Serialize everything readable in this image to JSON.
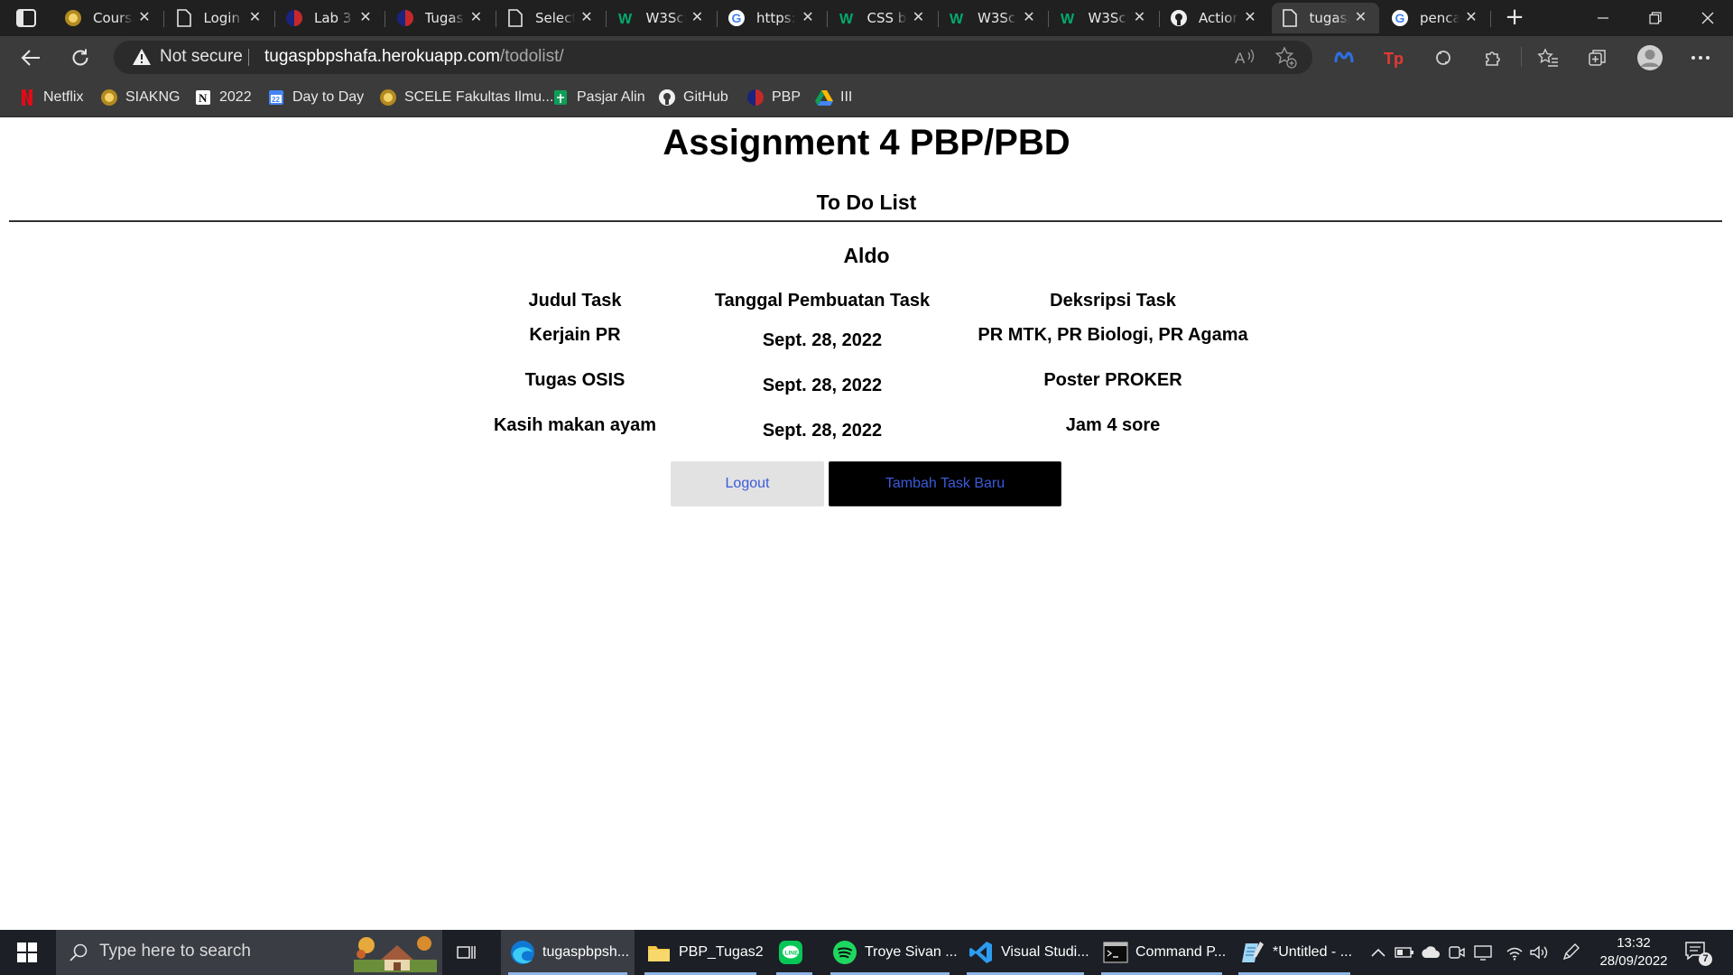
{
  "browser": {
    "tabs": [
      {
        "title": "Course",
        "icon": "university-crest-icon"
      },
      {
        "title": "Login",
        "icon": "page-icon"
      },
      {
        "title": "Lab 3:",
        "icon": "pbp-logo-icon"
      },
      {
        "title": "Tugas",
        "icon": "pbp-logo-icon"
      },
      {
        "title": "Select",
        "icon": "page-icon"
      },
      {
        "title": "W3Sch",
        "icon": "w3schools-icon"
      },
      {
        "title": "https:/",
        "icon": "google-icon"
      },
      {
        "title": "CSS b",
        "icon": "w3schools-icon"
      },
      {
        "title": "W3Sch",
        "icon": "w3schools-icon"
      },
      {
        "title": "W3Sch",
        "icon": "w3schools-icon"
      },
      {
        "title": "Action",
        "icon": "github-icon"
      },
      {
        "title": "tugasp",
        "icon": "page-icon",
        "active": true
      },
      {
        "title": "penca",
        "icon": "google-icon"
      }
    ],
    "security_label": "Not secure",
    "url_host": "tugaspbpshafa.herokuapp.com",
    "url_path": "/todolist/",
    "bookmarks": [
      {
        "label": "Netflix",
        "icon": "netflix-icon"
      },
      {
        "label": "SIAKNG",
        "icon": "university-crest-icon"
      },
      {
        "label": "2022",
        "icon": "notion-icon"
      },
      {
        "label": "Day to Day",
        "icon": "calendar-icon"
      },
      {
        "label": "SCELE Fakultas Ilmu...",
        "icon": "university-crest-icon"
      },
      {
        "label": "Pasjar Alin",
        "icon": "sheets-icon"
      },
      {
        "label": "GitHub",
        "icon": "github-icon"
      },
      {
        "label": "PBP",
        "icon": "pbp-logo-icon"
      },
      {
        "label": "III",
        "icon": "drive-icon"
      }
    ]
  },
  "page": {
    "title": "Assignment 4 PBP/PBD",
    "subtitle": "To Do List",
    "user_name": "Aldo",
    "table": {
      "headers": [
        "Judul Task",
        "Tanggal Pembuatan Task",
        "Deksripsi Task"
      ],
      "rows": [
        [
          "Kerjain PR",
          "Sept. 28, 2022",
          "PR MTK, PR Biologi, PR Agama"
        ],
        [
          "Tugas OSIS",
          "Sept. 28, 2022",
          "Poster PROKER"
        ],
        [
          "Kasih makan ayam",
          "Sept. 28, 2022",
          "Jam 4 sore"
        ]
      ]
    },
    "logout_label": "Logout",
    "add_task_label": "Tambah Task Baru"
  },
  "taskbar": {
    "search_placeholder": "Type here to search",
    "apps": [
      {
        "label": "tugaspbpsh...",
        "icon": "edge-icon",
        "active": true
      },
      {
        "label": "PBP_Tugas2",
        "icon": "folder-icon"
      },
      {
        "label": "",
        "icon": "line-icon"
      },
      {
        "label": "Troye Sivan ...",
        "icon": "spotify-icon"
      },
      {
        "label": "Visual Studi...",
        "icon": "vscode-icon"
      },
      {
        "label": "Command P...",
        "icon": "terminal-icon"
      },
      {
        "label": "*Untitled - ...",
        "icon": "notepad-icon"
      }
    ],
    "time": "13:32",
    "date": "28/09/2022",
    "notification_count": "7"
  }
}
